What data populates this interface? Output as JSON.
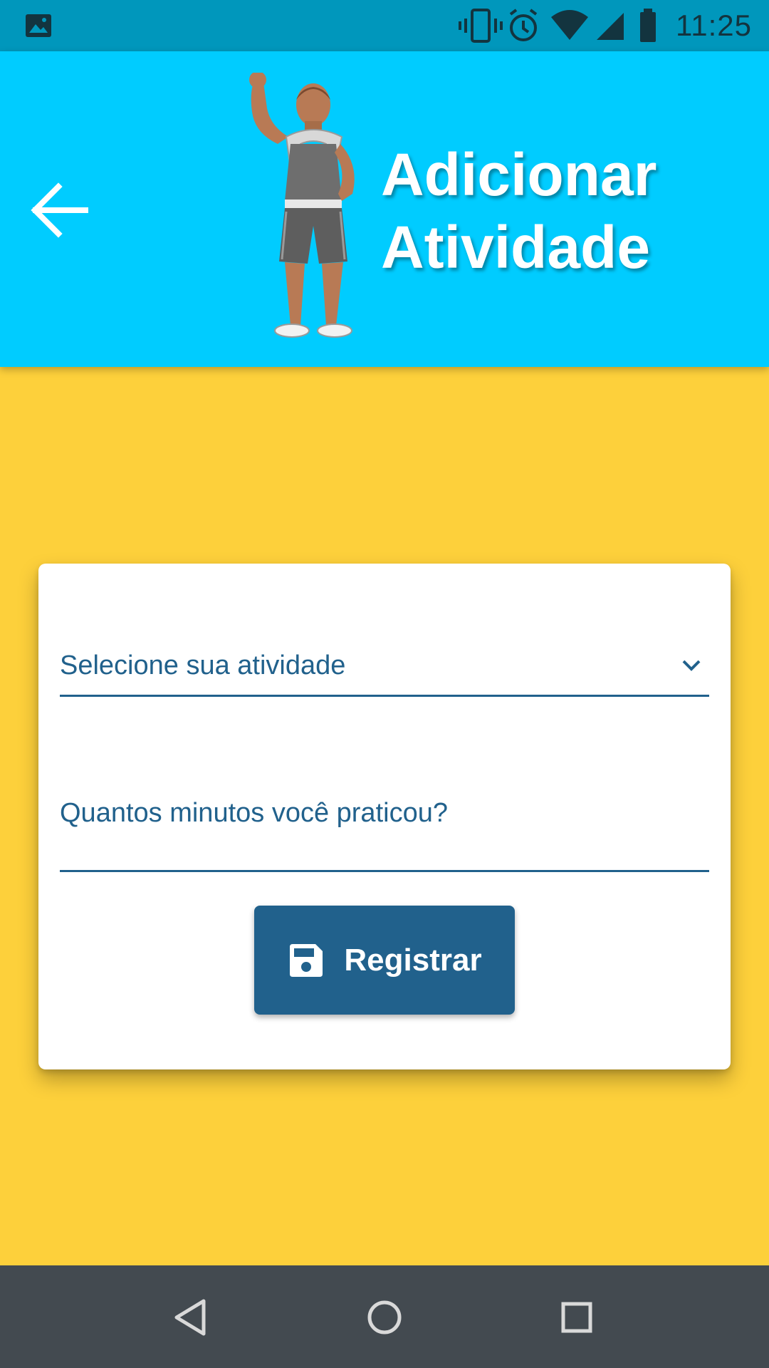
{
  "status_bar": {
    "time": "11:25",
    "icons": [
      "image-icon",
      "vibrate-icon",
      "alarm-icon",
      "wifi-icon",
      "signal-icon",
      "battery-icon"
    ]
  },
  "header": {
    "title_line1": "Adicionar",
    "title_line2": "Atividade",
    "background": "#00CCFF",
    "back_icon": "arrow-left-icon",
    "mascot": "fitness-mascot"
  },
  "form": {
    "activity_select": {
      "selected_text": "Selecione sua atividade",
      "icon": "chevron-down-icon"
    },
    "minutes_input": {
      "value": "",
      "placeholder": "Quantos minutos você praticou?"
    },
    "register_button": {
      "label": "Registrar",
      "icon": "floppy-save-icon",
      "color": "#21618C"
    }
  },
  "nav_bar": {
    "buttons": [
      "back-triangle-icon",
      "home-circle-icon",
      "recents-square-icon"
    ]
  },
  "colors": {
    "page_background": "#FDD03B",
    "status_bar": "#0097BC",
    "accent": "#21618C",
    "nav_bar": "#434A50"
  }
}
